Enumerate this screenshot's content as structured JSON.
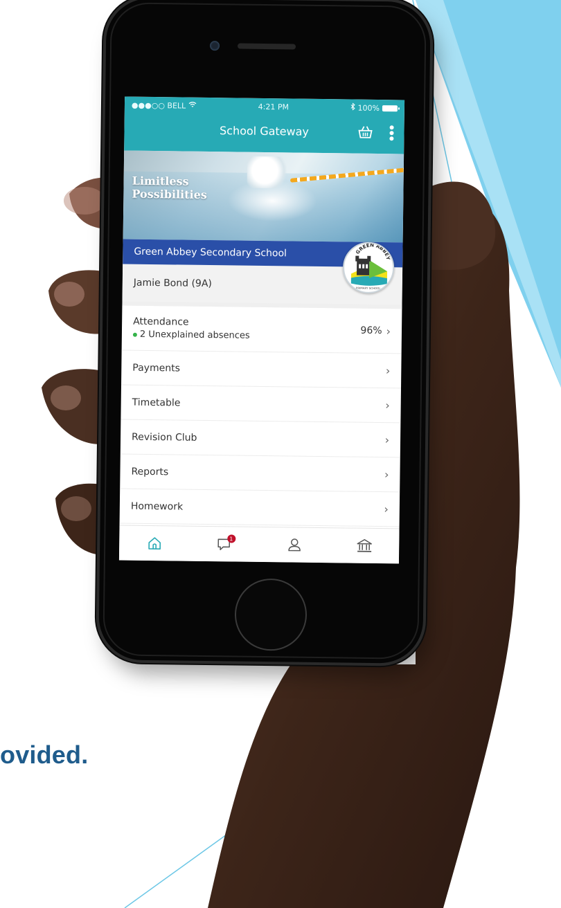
{
  "slide": {
    "caption": "ovided."
  },
  "status_bar": {
    "carrier": "●●●○○ BELL",
    "time": "4:21 PM",
    "battery": "100%"
  },
  "app": {
    "title": "School Gateway"
  },
  "banner": {
    "tagline_line1": "Limitless",
    "tagline_line2": "Possibilities",
    "school_name": "Green Abbey Secondary School",
    "logo_text_top": "GREEN ABBEY",
    "logo_text_bottom": "PRIMARY SCHOOL"
  },
  "student": {
    "name": "Jamie Bond (9A)"
  },
  "menu": {
    "attendance": {
      "label": "Attendance",
      "value": "96%",
      "note": "2 Unexplained absences"
    },
    "items": [
      {
        "label": "Payments"
      },
      {
        "label": "Timetable"
      },
      {
        "label": "Revision Club"
      },
      {
        "label": "Reports"
      },
      {
        "label": "Homework"
      }
    ]
  },
  "tabs": {
    "messages_badge": "1",
    "icons": [
      "home-icon",
      "messages-icon",
      "profile-icon",
      "school-icon"
    ]
  },
  "colors": {
    "header": "#27aab5",
    "school_bar": "#2a4fa8",
    "caption": "#1f5c8c",
    "accent_green": "#35b34a",
    "badge": "#c0102a"
  }
}
